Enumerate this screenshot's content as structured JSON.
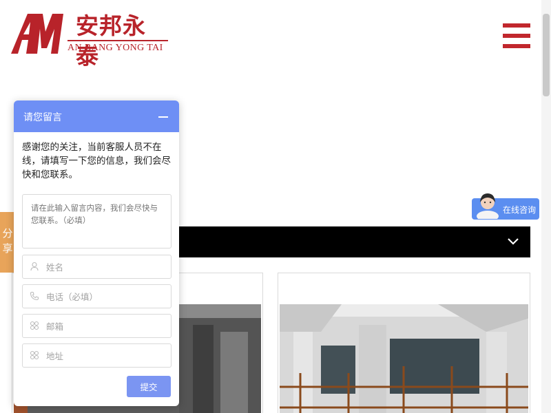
{
  "brand": {
    "name_cn": "安邦永泰",
    "name_en": "AN BANG YONG TAI",
    "logo_icon": "am-monogram-icon",
    "color": "#b8232a"
  },
  "header": {
    "menu_icon": "hamburger-menu-icon"
  },
  "share_tab": {
    "label": "分享"
  },
  "consult": {
    "label": "在线咨询",
    "icon": "customer-service-avatar-icon",
    "color": "#5b8ef0"
  },
  "dark_bar": {
    "icon": "chevron-down-icon"
  },
  "chat": {
    "title": "请您留言",
    "minimize_icon": "minimize-icon",
    "message": "感谢您的关注，当前客服人员不在线，请填写一下您的信息，我们会尽快和您联系。",
    "textarea_placeholder": "请在此输入留言内容，我们会尽快与您联系。（必填）",
    "fields": [
      {
        "icon": "user-icon",
        "placeholder": "姓名",
        "value": ""
      },
      {
        "icon": "phone-icon",
        "placeholder": "电话（必填）",
        "value": ""
      },
      {
        "icon": "email-icon",
        "placeholder": "邮箱",
        "value": ""
      },
      {
        "icon": "address-icon",
        "placeholder": "地址",
        "value": ""
      }
    ],
    "submit_label": "提交",
    "header_color": "#6e8ff5"
  },
  "cards": [
    {
      "image": "building-facade-photo"
    },
    {
      "image": "building-scaffolding-photo"
    }
  ]
}
